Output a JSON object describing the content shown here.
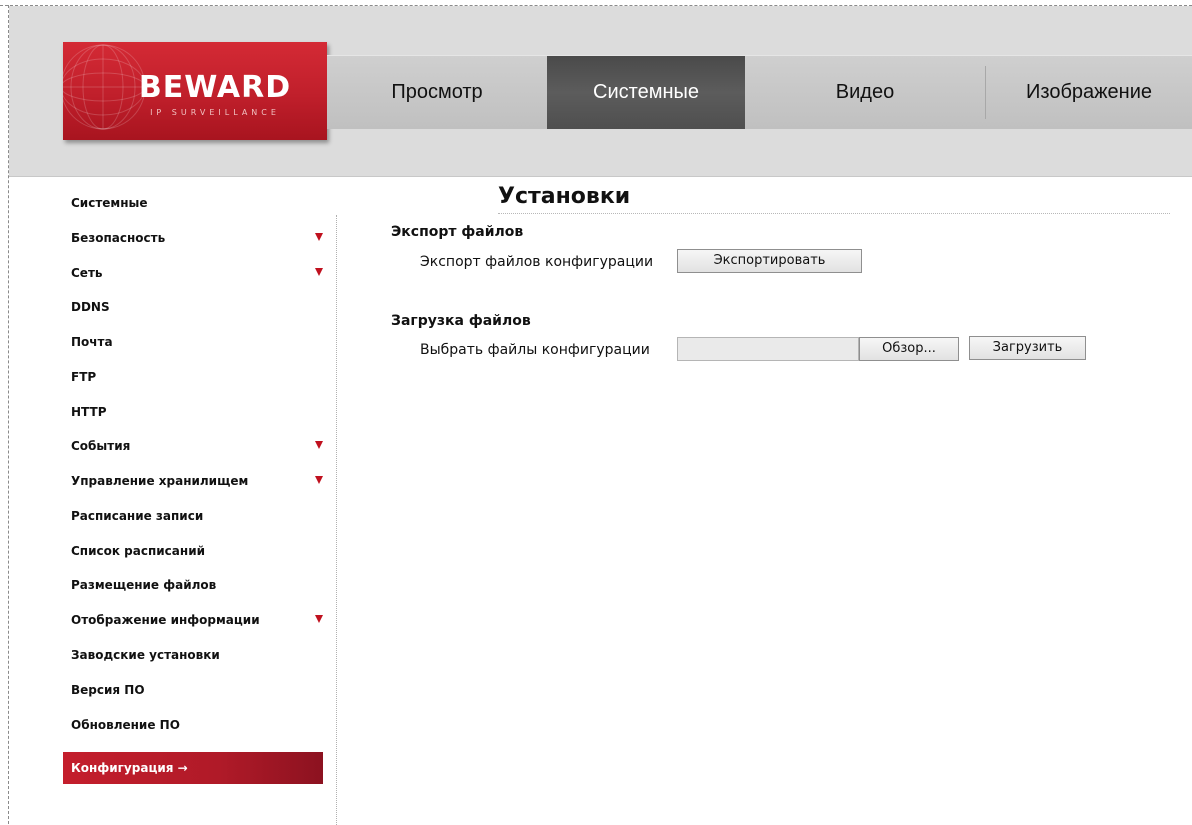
{
  "logo": {
    "brand": "BEWARD",
    "tagline": "IP SURVEILLANCE"
  },
  "topnav": {
    "tabs": [
      {
        "label": "Просмотр",
        "active": false
      },
      {
        "label": "Системные",
        "active": true
      },
      {
        "label": "Видео",
        "active": false
      },
      {
        "label": "Изображение",
        "active": false
      }
    ]
  },
  "sidebar": {
    "items": [
      {
        "label": "Системные",
        "has_submenu": false
      },
      {
        "label": "Безопасность",
        "has_submenu": true
      },
      {
        "label": "Сеть",
        "has_submenu": true
      },
      {
        "label": "DDNS",
        "has_submenu": false
      },
      {
        "label": "Почта",
        "has_submenu": false
      },
      {
        "label": "FTP",
        "has_submenu": false
      },
      {
        "label": "HTTP",
        "has_submenu": false
      },
      {
        "label": "События",
        "has_submenu": true
      },
      {
        "label": "Управление хранилищем",
        "has_submenu": true
      },
      {
        "label": "Расписание записи",
        "has_submenu": false
      },
      {
        "label": "Список расписаний",
        "has_submenu": false
      },
      {
        "label": "Размещение файлов",
        "has_submenu": false
      },
      {
        "label": "Отображение информации",
        "has_submenu": true
      },
      {
        "label": "Заводские установки",
        "has_submenu": false
      },
      {
        "label": "Версия ПО",
        "has_submenu": false
      },
      {
        "label": "Обновление ПО",
        "has_submenu": false
      },
      {
        "label": "Конфигурация →",
        "has_submenu": false,
        "active": true
      }
    ]
  },
  "main": {
    "title": "Установки",
    "export": {
      "heading": "Экспорт файлов",
      "label": "Экспорт файлов конфигурации",
      "button": "Экспортировать"
    },
    "upload": {
      "heading": "Загрузка файлов",
      "label": "Выбрать файлы конфигурации",
      "file_value": "",
      "browse_button": "Обзор...",
      "upload_button": "Загрузить"
    }
  },
  "colors": {
    "brand_red": "#c41e2c",
    "active_tab": "#4f4f4f",
    "header_bg": "#dcdcdc"
  }
}
